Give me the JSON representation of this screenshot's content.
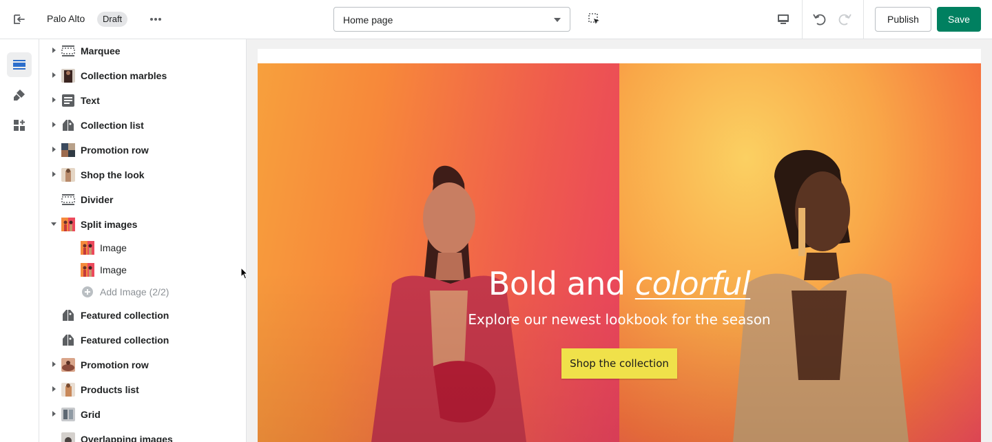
{
  "topbar": {
    "store_name": "Palo Alto",
    "badge": "Draft",
    "page_select": "Home page",
    "publish_label": "Publish",
    "save_label": "Save"
  },
  "icons": {
    "exit": "exit-icon",
    "more": "more-horizontal-icon",
    "inspect": "select-inspect-icon",
    "desktop": "desktop-icon",
    "undo": "undo-icon",
    "redo": "redo-icon",
    "sections": "sections-icon",
    "theme_settings": "brush-icon",
    "apps": "apps-icon"
  },
  "sidebar": {
    "items": [
      {
        "label": "Marquee",
        "caret": "closed",
        "icon": "layout-section-icon"
      },
      {
        "label": "Collection marbles",
        "caret": "closed",
        "icon": "image-thumb"
      },
      {
        "label": "Text",
        "caret": "closed",
        "icon": "text-block-icon"
      },
      {
        "label": "Collection list",
        "caret": "closed",
        "icon": "collection-icon"
      },
      {
        "label": "Promotion row",
        "caret": "closed",
        "icon": "image-thumb"
      },
      {
        "label": "Shop the look",
        "caret": "closed",
        "icon": "image-thumb"
      },
      {
        "label": "Divider",
        "caret": "none",
        "icon": "layout-section-icon"
      },
      {
        "label": "Split images",
        "caret": "open",
        "icon": "image-thumb"
      },
      {
        "label": "Featured collection",
        "caret": "none",
        "icon": "collection-icon"
      },
      {
        "label": "Featured collection",
        "caret": "none",
        "icon": "collection-icon"
      },
      {
        "label": "Promotion row",
        "caret": "closed",
        "icon": "image-thumb"
      },
      {
        "label": "Products list",
        "caret": "closed",
        "icon": "image-thumb"
      },
      {
        "label": "Grid",
        "caret": "closed",
        "icon": "image-thumb"
      },
      {
        "label": "Overlapping images",
        "caret": "none",
        "icon": "image-thumb"
      }
    ],
    "sub_items": [
      {
        "label": "Image"
      },
      {
        "label": "Image"
      }
    ],
    "add_label": "Add Image (2/2)"
  },
  "hero": {
    "title_plain": "Bold and ",
    "title_emph": "colorful",
    "subtitle": "Explore our newest lookbook for the season",
    "button_label": "Shop the collection"
  },
  "colors": {
    "save_green": "#008060",
    "hero_button": "#f0e14a",
    "rail_active": "#2c6ecb"
  }
}
